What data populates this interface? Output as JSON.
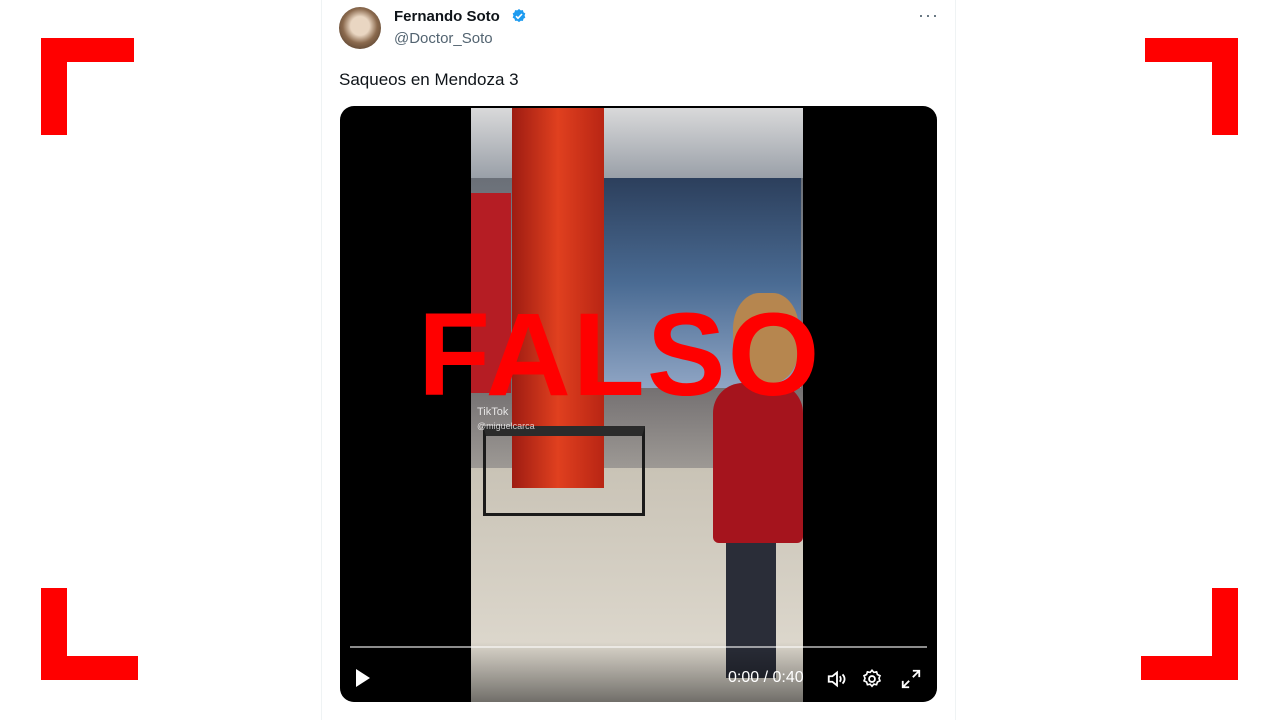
{
  "stamp": {
    "text": "FALSO",
    "color": "#ff0000"
  },
  "tweet": {
    "author_name": "Fernando Soto",
    "author_handle": "@Doctor_Soto",
    "verified": true,
    "more_label": "···",
    "text": "Saqueos en Mendoza 3"
  },
  "video": {
    "watermark": "TikTok",
    "watermark_user": "@miguelcarca",
    "timecode": "0:00 / 0:40",
    "progress_fraction": 0,
    "controls": {
      "play_icon": "play-icon",
      "volume_icon": "volume-icon",
      "settings_icon": "gear-icon",
      "fullscreen_icon": "expand-icon"
    }
  },
  "colors": {
    "verified": "#1d9bf0",
    "text": "#0f1419",
    "secondary": "#536471"
  }
}
